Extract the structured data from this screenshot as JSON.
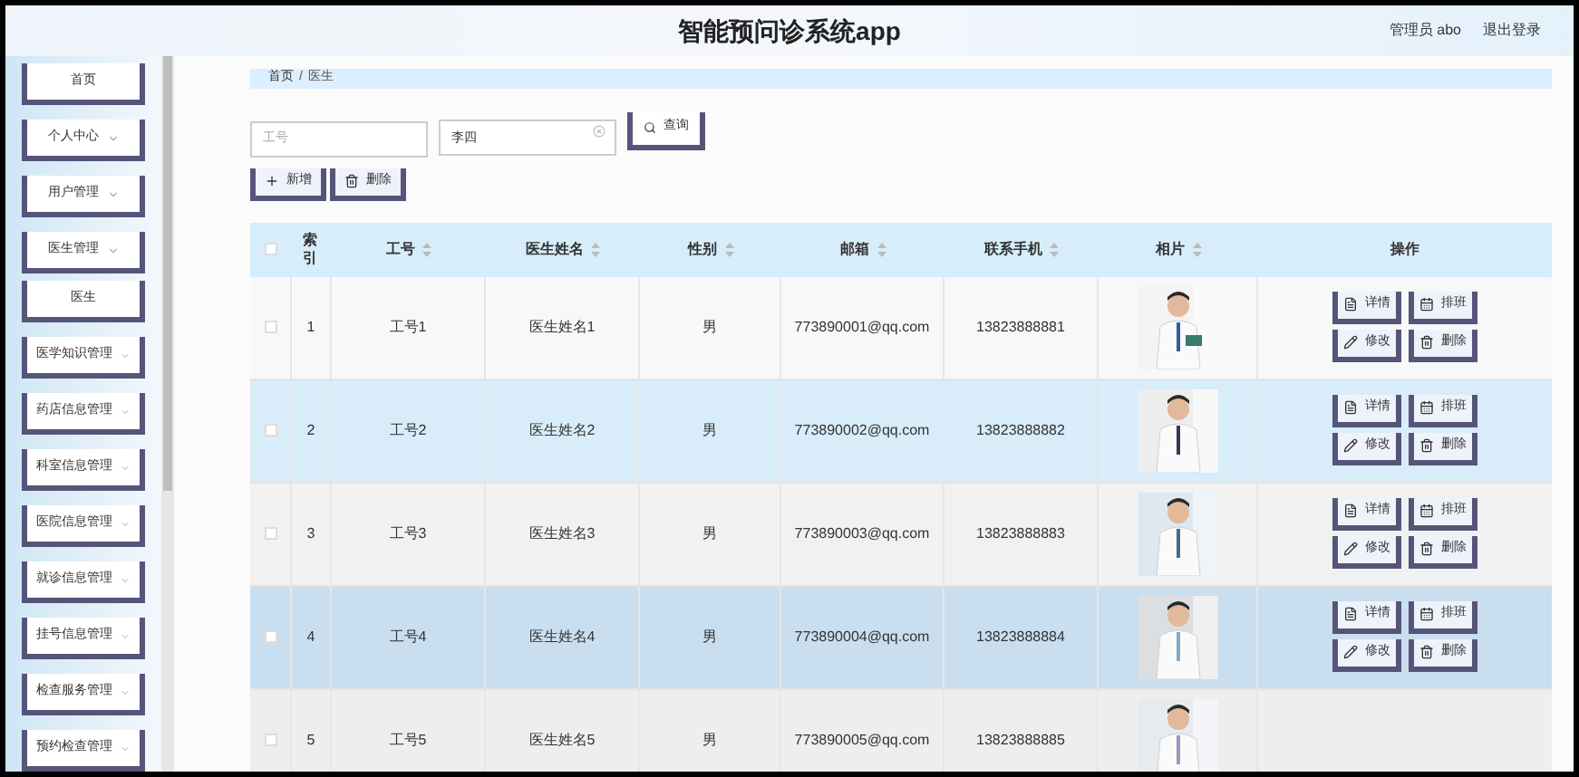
{
  "header": {
    "title": "智能预问诊系统app",
    "user": "管理员 abo",
    "logout": "退出登录"
  },
  "sidebar": {
    "items": [
      {
        "label": "首页",
        "kind": "link"
      },
      {
        "label": "个人中心",
        "kind": "menu"
      },
      {
        "label": "用户管理",
        "kind": "menu"
      },
      {
        "label": "医生管理",
        "kind": "menu",
        "children": [
          {
            "label": "医生"
          }
        ]
      },
      {
        "label": "医学知识管理",
        "kind": "menu"
      },
      {
        "label": "药店信息管理",
        "kind": "menu"
      },
      {
        "label": "科室信息管理",
        "kind": "menu"
      },
      {
        "label": "医院信息管理",
        "kind": "menu"
      },
      {
        "label": "就诊信息管理",
        "kind": "menu"
      },
      {
        "label": "挂号信息管理",
        "kind": "menu"
      },
      {
        "label": "检查服务管理",
        "kind": "menu"
      },
      {
        "label": "预约检查管理",
        "kind": "menu"
      }
    ]
  },
  "breadcrumb": [
    "首页",
    "/",
    "医生"
  ],
  "search": {
    "fields": [
      {
        "placeholder": "工号"
      },
      {
        "value": "李四"
      }
    ],
    "button": "查询"
  },
  "toolbar": [
    {
      "label": "新增",
      "kind": "add"
    },
    {
      "label": "删除",
      "kind": "delete"
    }
  ],
  "table": {
    "select_all": {
      "checked": false
    },
    "columns": [
      {
        "label": "索引",
        "sortable": false
      },
      {
        "label": "工号",
        "sortable": true
      },
      {
        "label": "医生姓名",
        "sortable": true
      },
      {
        "label": "性别",
        "sortable": true
      },
      {
        "label": "邮箱",
        "sortable": true
      },
      {
        "label": "联系手机",
        "sortable": true
      },
      {
        "label": "相片",
        "sortable": true
      },
      {
        "label": "操作",
        "sortable": false
      }
    ],
    "rows": [
      {
        "checked": false,
        "cells": [
          "1",
          "工号1",
          "医生姓名1",
          "男",
          "773890001@qq.com",
          "13823888881"
        ],
        "photo": {
          "kind": "picture"
        },
        "actions": [
          {
            "label": "详情",
            "kind": "detail"
          },
          {
            "label": "排班",
            "kind": "schedule"
          },
          {
            "label": "修改",
            "kind": "edit"
          },
          {
            "label": "删除",
            "kind": "delete"
          }
        ]
      },
      {
        "checked": false,
        "cells": [
          "2",
          "工号2",
          "医生姓名2",
          "男",
          "773890002@qq.com",
          "13823888882"
        ],
        "photo": {
          "kind": "picture"
        },
        "actions": [
          {
            "label": "详情",
            "kind": "detail"
          },
          {
            "label": "排班",
            "kind": "schedule"
          },
          {
            "label": "修改",
            "kind": "edit"
          },
          {
            "label": "删除",
            "kind": "delete"
          }
        ]
      },
      {
        "checked": false,
        "cells": [
          "3",
          "工号3",
          "医生姓名3",
          "男",
          "773890003@qq.com",
          "13823888883"
        ],
        "photo": {
          "kind": "picture"
        },
        "actions": [
          {
            "label": "详情",
            "kind": "detail"
          },
          {
            "label": "排班",
            "kind": "schedule"
          },
          {
            "label": "修改",
            "kind": "edit"
          },
          {
            "label": "删除",
            "kind": "delete"
          }
        ]
      },
      {
        "checked": false,
        "cells": [
          "4",
          "工号4",
          "医生姓名4",
          "男",
          "773890004@qq.com",
          "13823888884"
        ],
        "photo": {
          "kind": "picture"
        },
        "actions": [
          {
            "label": "详情",
            "kind": "detail"
          },
          {
            "label": "排班",
            "kind": "schedule"
          },
          {
            "label": "修改",
            "kind": "edit"
          },
          {
            "label": "删除",
            "kind": "delete"
          }
        ]
      },
      {
        "checked": false,
        "cells": [
          "5",
          "工号5",
          "医生姓名5",
          "男",
          "773890005@qq.com",
          "13823888885"
        ],
        "photo": {
          "kind": "picture"
        },
        "actions": []
      }
    ]
  }
}
